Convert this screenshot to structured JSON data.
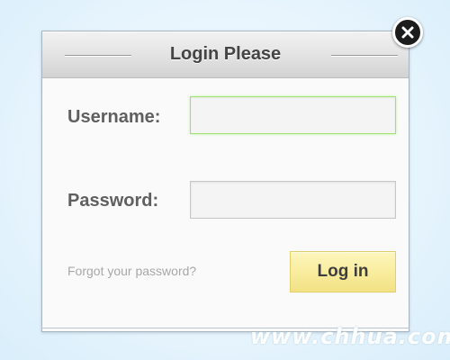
{
  "dialog": {
    "title": "Login Please",
    "username_label": "Username:",
    "username_value": "",
    "password_label": "Password:",
    "password_value": "",
    "forgot_link": "Forgot your password?",
    "login_button": "Log in",
    "close_icon": "close-icon"
  },
  "colors": {
    "focus_border": "#9ee26f",
    "button_fill": "#f8ec9c",
    "title_text": "#444444",
    "label_text": "#5f5f5f",
    "link_text": "#a8a8a8"
  },
  "watermark": {
    "text": "www.chhua.com"
  }
}
